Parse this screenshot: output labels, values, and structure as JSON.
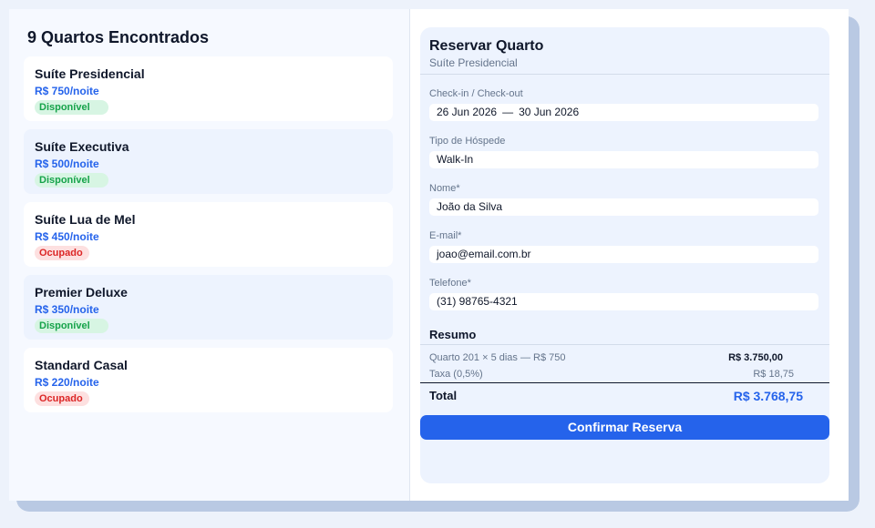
{
  "list": {
    "title": "9 Quartos Encontrados",
    "rooms": [
      {
        "name": "Suíte Presidencial",
        "price": "R$ 750/noite",
        "status": "Disponível",
        "status_kind": "available"
      },
      {
        "name": "Suíte Executiva",
        "price": "R$ 500/noite",
        "status": "Disponível",
        "status_kind": "available"
      },
      {
        "name": "Suíte Lua de Mel",
        "price": "R$ 450/noite",
        "status": "Ocupado",
        "status_kind": "occupied"
      },
      {
        "name": "Premier Deluxe",
        "price": "R$ 350/noite",
        "status": "Disponível",
        "status_kind": "available"
      },
      {
        "name": "Standard Casal",
        "price": "R$ 220/noite",
        "status": "Ocupado",
        "status_kind": "occupied"
      }
    ]
  },
  "booking": {
    "title": "Reservar Quarto",
    "subtitle": "Suíte Presidencial",
    "dates": {
      "label": "Check-in / Check-out",
      "checkin": "26 Jun 2026",
      "separator": "—",
      "checkout": "30 Jun 2026"
    },
    "guest_type": {
      "label": "Tipo de Hóspede",
      "value": "Walk-In"
    },
    "name": {
      "label": "Nome*",
      "value": "João da Silva"
    },
    "email": {
      "label": "E-mail*",
      "value": "joao@email.com.br"
    },
    "phone": {
      "label": "Telefone*",
      "value": "(31) 98765-4321"
    },
    "summary": {
      "title": "Resumo",
      "room_line": {
        "label": "Quarto 201 × 5 dias — R$ 750",
        "value": "R$ 3.750,00"
      },
      "tax_line": {
        "label": "Taxa (0,5%)",
        "value": "R$ 18,75"
      },
      "total": {
        "label": "Total",
        "value": "R$ 3.768,75"
      }
    },
    "confirm_label": "Confirmar Reserva"
  },
  "colors": {
    "accent": "#2563eb",
    "available_bg": "#d7f5e3",
    "available_text": "#16a34a",
    "occupied_bg": "#fde0e0",
    "occupied_text": "#dc2626"
  }
}
